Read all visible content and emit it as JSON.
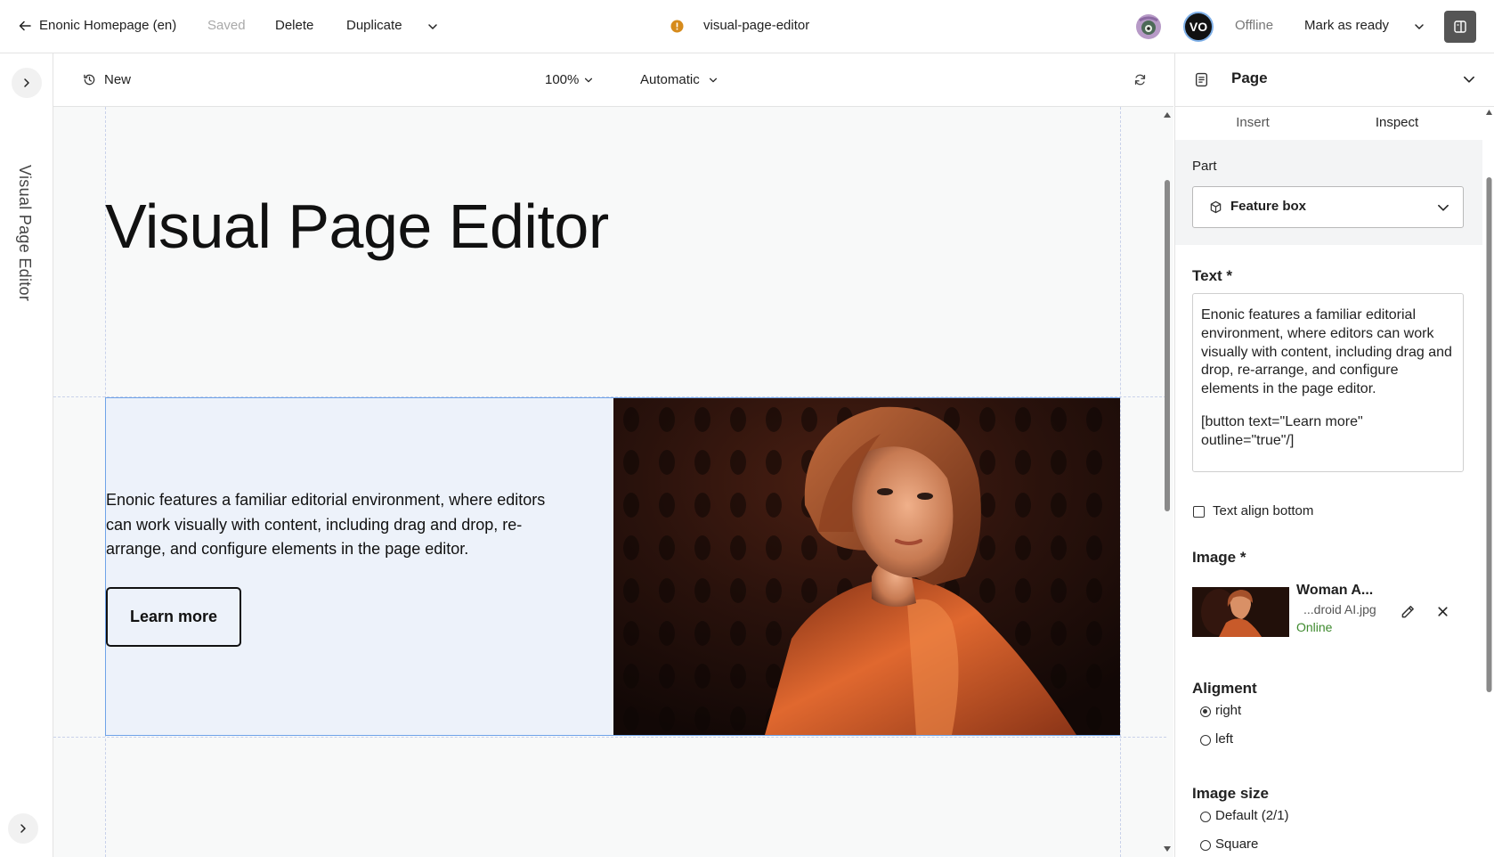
{
  "topbar": {
    "back_label": "Enonic Homepage (en)",
    "saved_label": "Saved",
    "delete_label": "Delete",
    "duplicate_label": "Duplicate",
    "content_name": "visual-page-editor",
    "avatar_initials": "VO",
    "status": "Offline",
    "mark_ready_label": "Mark as ready"
  },
  "leftrail": {
    "title": "Visual Page Editor"
  },
  "canvasbar": {
    "version_label": "New",
    "zoom": "100%",
    "device": "Automatic"
  },
  "canvas": {
    "heading": "Visual Page Editor",
    "feature_text": "Enonic features a familiar editorial environment, where editors can work visually with content, including drag and drop, re-arrange, and configure elements in the page editor.",
    "button_label": "Learn more"
  },
  "panel": {
    "title": "Page",
    "tabs": [
      "Insert",
      "Inspect"
    ],
    "active_tab": "Inspect",
    "part_label": "Part",
    "part_value": "Feature box",
    "text_label": "Text *",
    "text_value_p1": "Enonic features a familiar editorial environment, where editors can work visually with content, including drag and drop, re-arrange, and configure elements in the page editor.",
    "text_value_p2": "[button text=\"Learn more\" outline=\"true\"/]",
    "text_align_bottom_label": "Text align bottom",
    "image_label": "Image *",
    "image_name": "Woman A...",
    "image_file": "...droid AI.jpg",
    "image_status": "Online",
    "alignment_label": "Aligment",
    "alignment_options": [
      "right",
      "left"
    ],
    "alignment_selected": "right",
    "image_size_label": "Image size",
    "image_size_options": [
      "Default (2/1)",
      "Square"
    ]
  },
  "colors": {
    "accent_blue": "#6fa3e8",
    "online_green": "#3e8a2e",
    "warning_amber": "#d68b1c",
    "feature_bg": "#edf2fa"
  }
}
